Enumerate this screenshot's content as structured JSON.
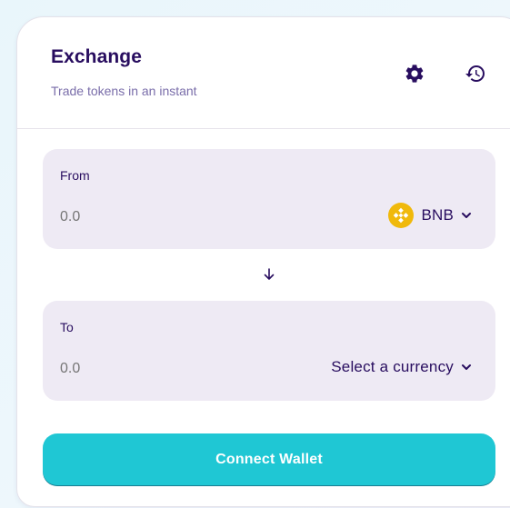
{
  "header": {
    "title": "Exchange",
    "subtitle": "Trade tokens in an instant",
    "settings_icon": "gear-icon",
    "history_icon": "history-icon"
  },
  "from": {
    "label": "From",
    "amount_placeholder": "0.0",
    "currency": "BNB",
    "token_icon": "bnb-token-icon"
  },
  "switch_icon": "arrow-down-icon",
  "to": {
    "label": "To",
    "amount_placeholder": "0.0",
    "currency": "Select a currency"
  },
  "connect_button": {
    "label": "Connect Wallet"
  },
  "colors": {
    "primary": "#1fc7d4",
    "text": "#280d5f",
    "text_subtle": "#7a6eaa",
    "panel_bg": "#eeeaf4",
    "bnb_yellow": "#f0b90b"
  }
}
